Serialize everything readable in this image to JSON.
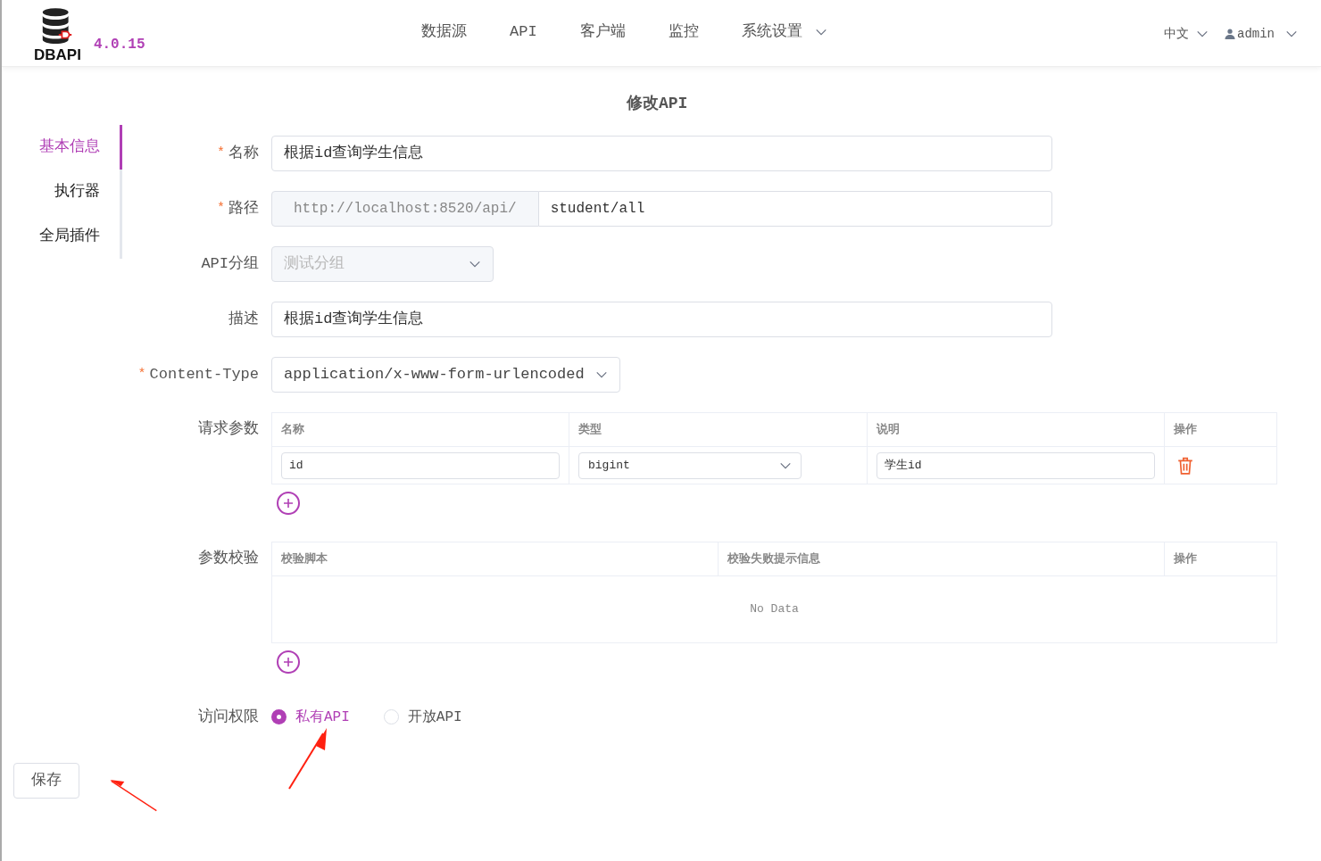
{
  "header": {
    "logo_text": "DBAPI",
    "version": "4.0.15",
    "nav": [
      {
        "label": "数据源",
        "dropdown": false
      },
      {
        "label": "API",
        "dropdown": false
      },
      {
        "label": "客户端",
        "dropdown": false
      },
      {
        "label": "监控",
        "dropdown": false
      },
      {
        "label": "系统设置",
        "dropdown": true
      }
    ],
    "language": "中文",
    "user": "admin"
  },
  "title": "修改API",
  "sidebar": {
    "items": [
      {
        "label": "基本信息",
        "selected": true
      },
      {
        "label": "执行器",
        "selected": false
      },
      {
        "label": "全局插件",
        "selected": false
      }
    ]
  },
  "form": [
    {
      "kind": "text",
      "required_mark": "*",
      "label": "名称",
      "value": "根据id查询学生信息"
    },
    {
      "kind": "url",
      "required_mark": "*",
      "label": "路径",
      "prefix": "http://localhost:8520/api/",
      "value": "student/all"
    },
    {
      "kind": "select",
      "label": "API分组",
      "value": "测试分组",
      "disabled": true
    },
    {
      "kind": "text",
      "label": "描述",
      "value": "根据id查询学生信息"
    },
    {
      "kind": "select",
      "required_mark": "*",
      "label": "Content-Type",
      "value": "application/x-www-form-urlencoded",
      "disabled": false
    }
  ],
  "request_params": {
    "label": "请求参数",
    "columns": [
      "名称",
      "类型",
      "说明",
      "操作"
    ],
    "rows": [
      {
        "name": "id",
        "type": "bigint",
        "description": "学生id"
      }
    ]
  },
  "validation": {
    "label": "参数校验",
    "columns": [
      "校验脚本",
      "校验失败提示信息",
      "操作"
    ],
    "empty_text": "No Data"
  },
  "access": {
    "label": "访问权限",
    "options": [
      {
        "label": "私有API",
        "selected": true
      },
      {
        "label": "开放API",
        "selected": false
      }
    ]
  },
  "save_button": "保存"
}
